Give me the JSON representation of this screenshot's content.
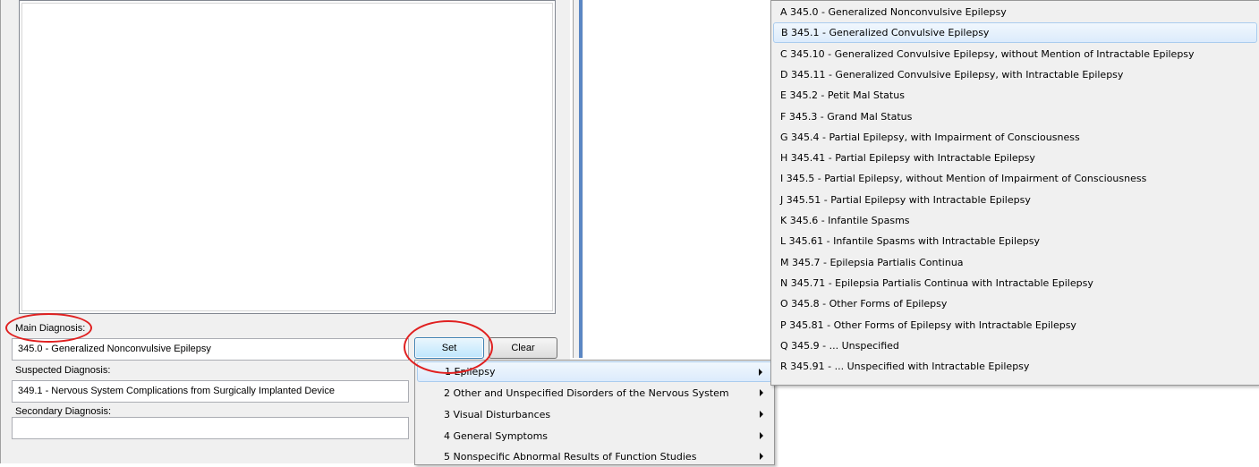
{
  "form": {
    "main_label": "Main Diagnosis:",
    "main_value": "345.0 - Generalized Nonconvulsive Epilepsy",
    "suspected_label": "Suspected Diagnosis:",
    "suspected_value": "349.1 - Nervous System Complications from Surgically Implanted Device",
    "secondary_label": "Secondary Diagnosis:",
    "secondary_value": "",
    "set_label": "Set",
    "clear_label": "Clear"
  },
  "main_menu": {
    "items": [
      {
        "label": "1 Epilepsy"
      },
      {
        "label": "2 Other and Unspecified Disorders of the Nervous System"
      },
      {
        "label": "3 Visual Disturbances"
      },
      {
        "label": "4 General Symptoms"
      },
      {
        "label": "5 Nonspecific Abnormal Results of Function Studies"
      }
    ]
  },
  "submenu": {
    "items": [
      {
        "label": "A 345.0 - Generalized Nonconvulsive Epilepsy"
      },
      {
        "label": "B 345.1 - Generalized Convulsive Epilepsy"
      },
      {
        "label": "C 345.10 - Generalized Convulsive Epilepsy, without Mention of Intractable Epilepsy"
      },
      {
        "label": "D 345.11 - Generalized Convulsive Epilepsy, with Intractable Epilepsy"
      },
      {
        "label": "E 345.2 - Petit Mal Status"
      },
      {
        "label": "F 345.3 - Grand Mal Status"
      },
      {
        "label": "G 345.4 - Partial Epilepsy, with Impairment of Consciousness"
      },
      {
        "label": "H 345.41 - Partial Epilepsy with Intractable Epilepsy"
      },
      {
        "label": "I 345.5 - Partial Epilepsy, without Mention of Impairment of Consciousness"
      },
      {
        "label": "J 345.51 - Partial Epilepsy with Intractable Epilepsy"
      },
      {
        "label": "K 345.6 - Infantile Spasms"
      },
      {
        "label": "L 345.61 - Infantile Spasms with Intractable Epilepsy"
      },
      {
        "label": "M 345.7 - Epilepsia Partialis Continua"
      },
      {
        "label": "N 345.71 - Epilepsia Partialis Continua with Intractable Epilepsy"
      },
      {
        "label": "O 345.8 - Other Forms of Epilepsy"
      },
      {
        "label": "P 345.81 - Other Forms of Epilepsy with Intractable Epilepsy"
      },
      {
        "label": "Q 345.9 - ... Unspecified"
      },
      {
        "label": "R 345.91 - ... Unspecified with Intractable Epilepsy"
      }
    ]
  },
  "colors": {
    "annotation": "#e02020",
    "highlight": "#dcebfc",
    "splitter": "#5b87c4"
  }
}
